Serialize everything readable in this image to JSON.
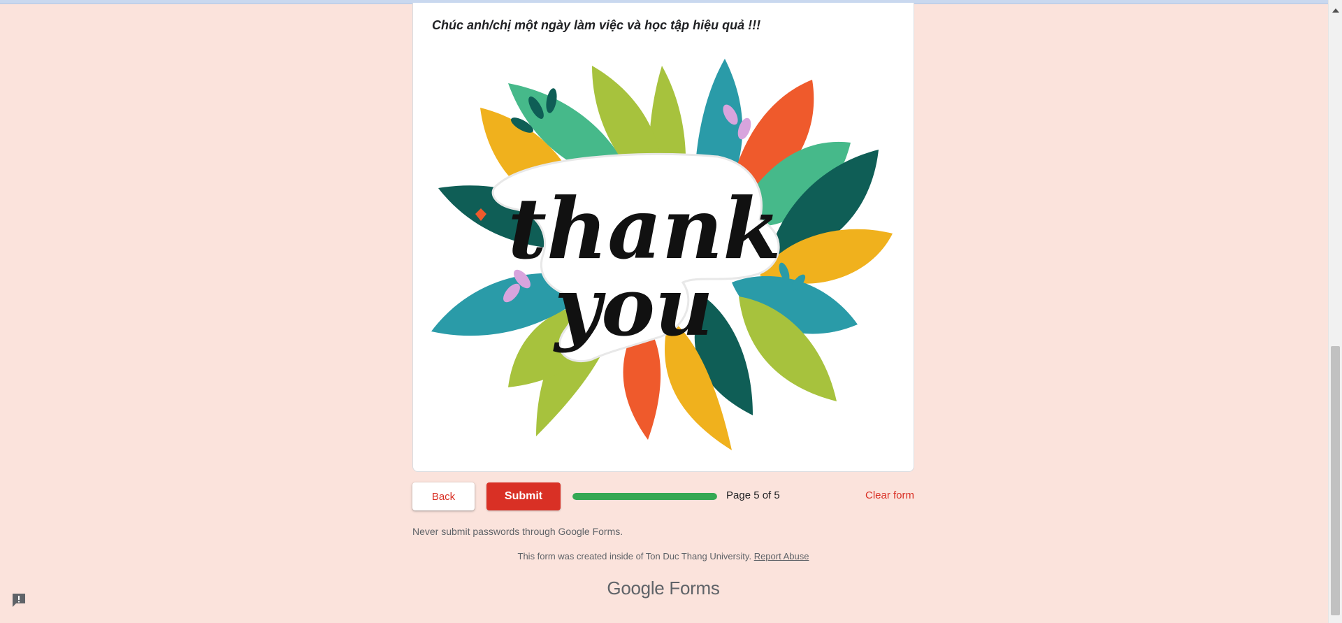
{
  "card": {
    "message": "Chúc anh/chị một ngày làm việc và học tập hiệu quả !!!",
    "image": {
      "name": "thank-you-illustration",
      "line1": "thank",
      "line2": "you"
    }
  },
  "navigation": {
    "back_label": "Back",
    "submit_label": "Submit",
    "progress_percent": 100,
    "page_label": "Page 5 of 5",
    "clear_label": "Clear form"
  },
  "footer": {
    "warning": "Never submit passwords through Google Forms.",
    "created_text": "This form was created inside of Ton Duc Thang University.",
    "report_label": "Report Abuse",
    "logo_google": "Google",
    "logo_forms": "Forms"
  },
  "colors": {
    "page_bg": "#fbe3dc",
    "accent": "#d93025",
    "progress": "#34a853"
  },
  "icons": {
    "feedback": "feedback-icon",
    "scroll_up": "chevron-up-icon"
  }
}
